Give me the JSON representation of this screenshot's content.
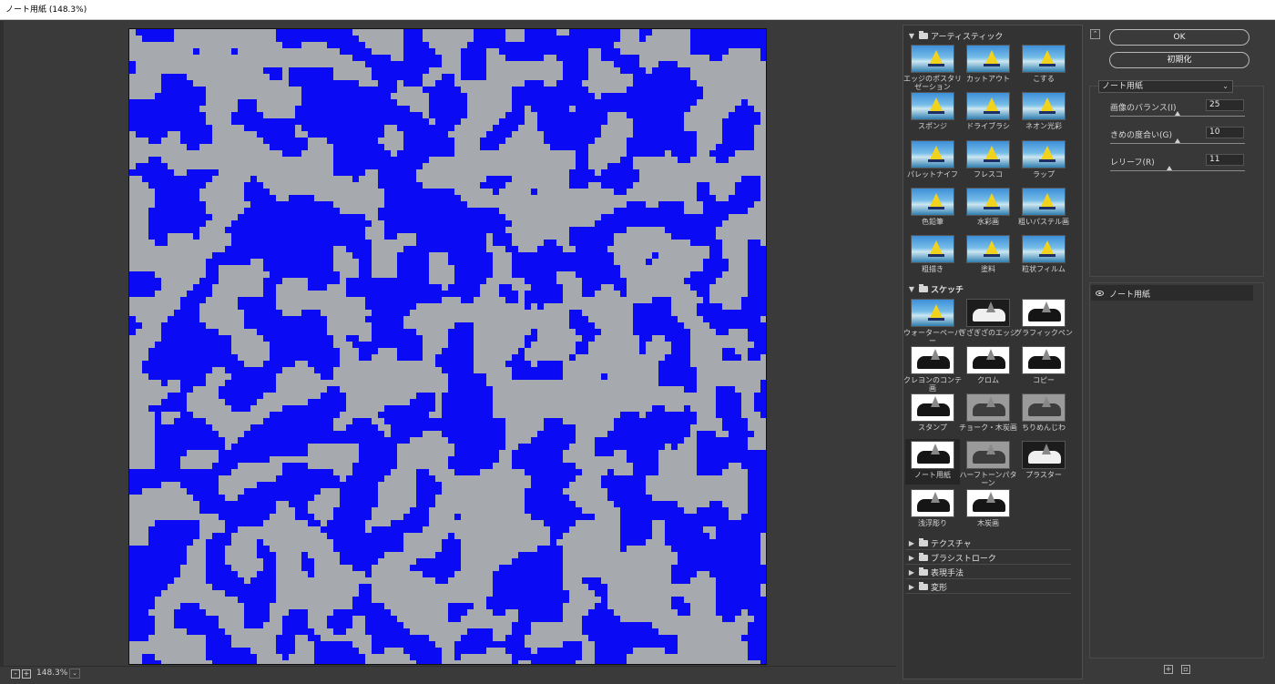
{
  "window": {
    "title": "ノート用紙 (148.3%)"
  },
  "preview": {
    "zoom": "148.3%",
    "colors": {
      "base": "#a6a9ad",
      "ink": "#0a0af5"
    }
  },
  "zoombar": {
    "minus": "-",
    "plus": "+",
    "dropdown": "⌄"
  },
  "gallery": {
    "folders": [
      {
        "name": "アーティスティック",
        "expanded": true,
        "filters": [
          "エッジのポスタリゼーション",
          "カットアウト",
          "こする",
          "スポンジ",
          "ドライブラシ",
          "ネオン光彩",
          "パレットナイフ",
          "フレスコ",
          "ラップ",
          "色鉛筆",
          "水彩画",
          "粗いパステル画",
          "粗描き",
          "塗料",
          "粒状フィルム"
        ]
      },
      {
        "name": "スケッチ",
        "expanded": true,
        "filters": [
          "ウォーターペーパー",
          "ぎざぎざのエッジ",
          "グラフィックペン",
          "クレヨンのコンテ画",
          "クロム",
          "コピー",
          "スタンプ",
          "チョーク・木炭画",
          "ちりめんじわ",
          "ノート用紙",
          "ハーフトーンパターン",
          "プラスター",
          "浅浮彫り",
          "木炭画"
        ],
        "selected": "ノート用紙"
      },
      {
        "name": "テクスチャ",
        "expanded": false
      },
      {
        "name": "ブラシストローク",
        "expanded": false
      },
      {
        "name": "表現手法",
        "expanded": false
      },
      {
        "name": "変形",
        "expanded": false
      }
    ]
  },
  "panel": {
    "ok_label": "OK",
    "reset_label": "初期化",
    "collapse": "⌃",
    "filter_select": "ノート用紙",
    "params": [
      {
        "label": "画像のバランス(I)",
        "value": "25",
        "fraction": 0.5
      },
      {
        "label": "きめの度合い(G)",
        "value": "10",
        "fraction": 0.5
      },
      {
        "label": "レリーフ(R)",
        "value": "11",
        "fraction": 0.44
      }
    ],
    "layer": {
      "name": "ノート用紙"
    },
    "new_layer": "+",
    "delete_layer": "▫"
  }
}
